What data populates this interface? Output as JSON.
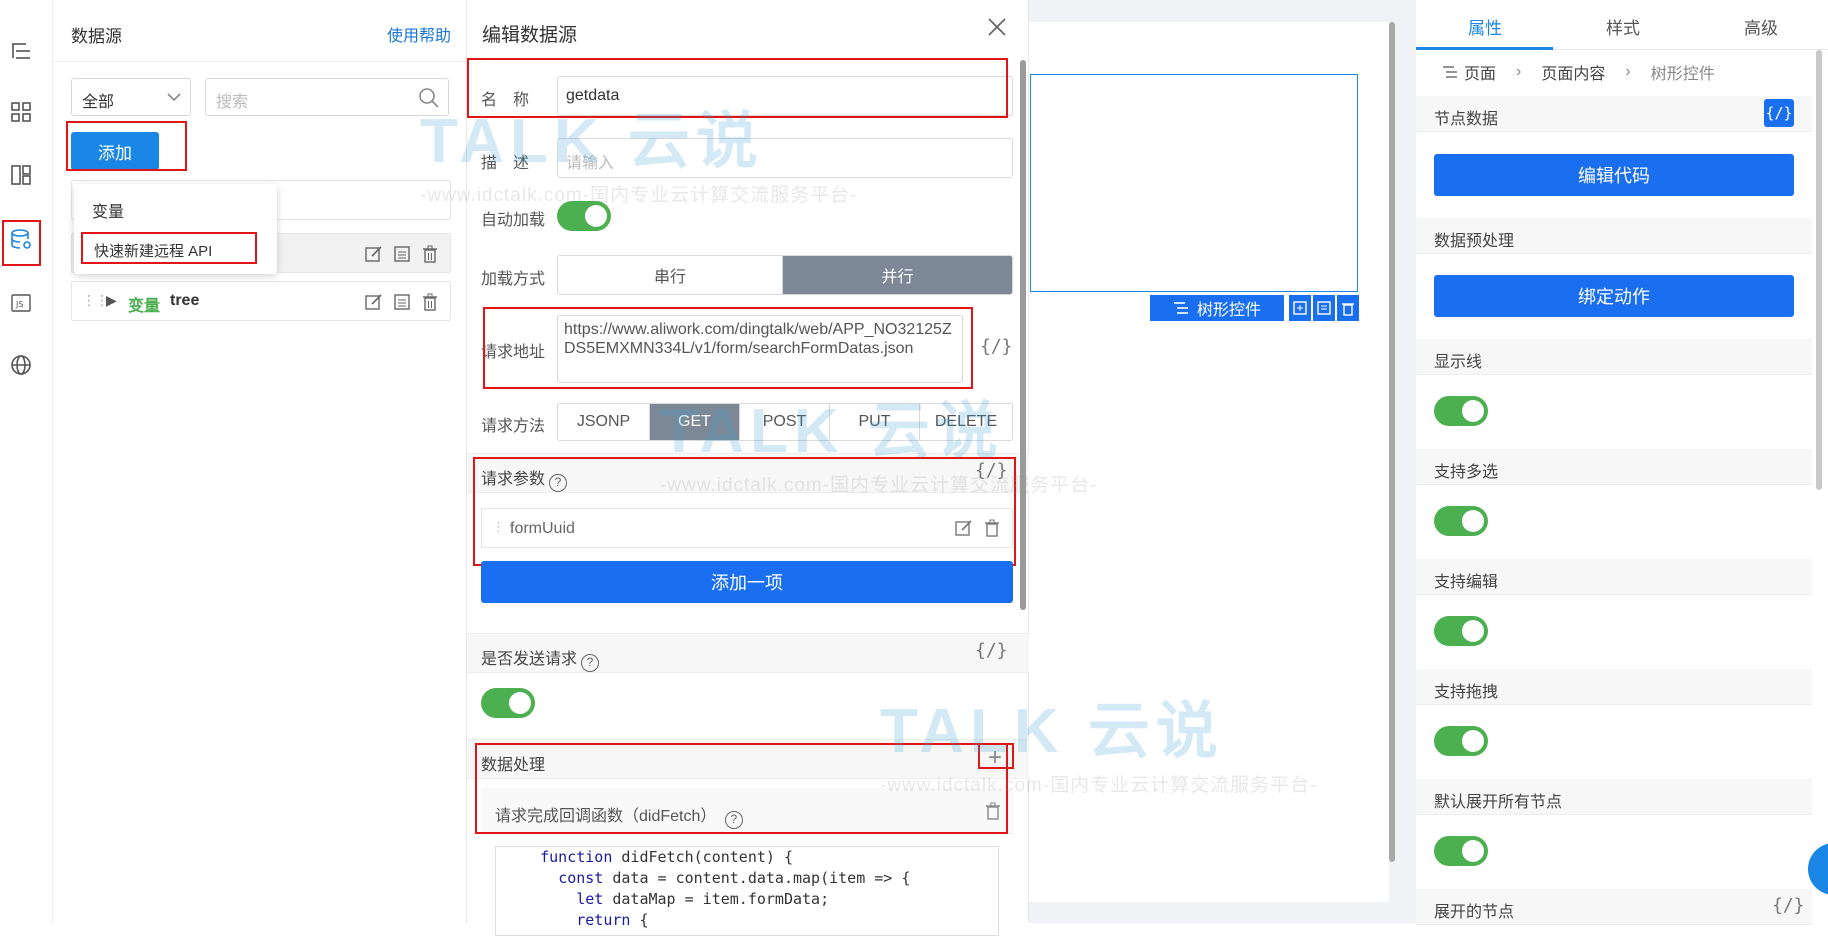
{
  "rail": {
    "icons": [
      "outline-tree-icon",
      "components-grid-icon",
      "layout-icon",
      "datasource-icon",
      "js-icon",
      "globe-icon"
    ],
    "js_label": "JS"
  },
  "datasource": {
    "title": "数据源",
    "help": "使用帮助",
    "filter_value": "全部",
    "search_placeholder": "搜索",
    "add_label": "添加",
    "menu": [
      "变量",
      "快速新建远程 API"
    ],
    "tree_item": {
      "type": "变量",
      "name": "tree"
    }
  },
  "edit": {
    "title": "编辑数据源",
    "name_label": "名　称",
    "name_value": "getdata",
    "desc_label": "描　述",
    "desc_placeholder": "请输入",
    "autoload_label": "自动加载",
    "load_mode_label": "加载方式",
    "load_modes": [
      "串行",
      "并行"
    ],
    "load_mode_active": 1,
    "url_label": "请求地址",
    "url_value": "https://www.aliwork.com/dingtalk/web/APP_NO32125ZDS5EMXMN334L/v1/form/searchFormDatas.json",
    "code_toggle": "{/}",
    "method_label": "请求方法",
    "methods": [
      "JSONP",
      "GET",
      "POST",
      "PUT",
      "DELETE"
    ],
    "method_active": 1,
    "params_label": "请求参数",
    "param_item": "formUuid",
    "add_item_label": "添加一项",
    "send_label": "是否发送请求",
    "processing_label": "数据处理",
    "plus": "+",
    "callback_label": "请求完成回调函数（didFetch）",
    "code_lines": [
      "    function didFetch(content) {",
      "      const data = content.data.map(item => {",
      "        let dataMap = item.formData;",
      "        return {"
    ]
  },
  "canvas": {
    "tree_tag": "树形控件"
  },
  "props": {
    "tabs": [
      "属性",
      "样式",
      "高级"
    ],
    "active_tab": 0,
    "breadcrumb": [
      "页面",
      "页面内容",
      "树形控件"
    ],
    "sections": [
      {
        "title": "节点数据",
        "button": "编辑代码"
      },
      {
        "title": "数据预处理",
        "button": "绑定动作"
      },
      {
        "title": "显示线"
      },
      {
        "title": "支持多选"
      },
      {
        "title": "支持编辑"
      },
      {
        "title": "支持拖拽"
      },
      {
        "title": "默认展开所有节点"
      },
      {
        "title": "展开的节点"
      }
    ],
    "var_badge": "{/}"
  },
  "watermark": {
    "logo": "TALK 云说",
    "sub": "-www.idctalk.com-国内专业云计算交流服务平台-"
  },
  "colors": {
    "accent": "#1a6ef0",
    "toggle_on": "#4cb050",
    "highlight_red": "#e01515"
  }
}
